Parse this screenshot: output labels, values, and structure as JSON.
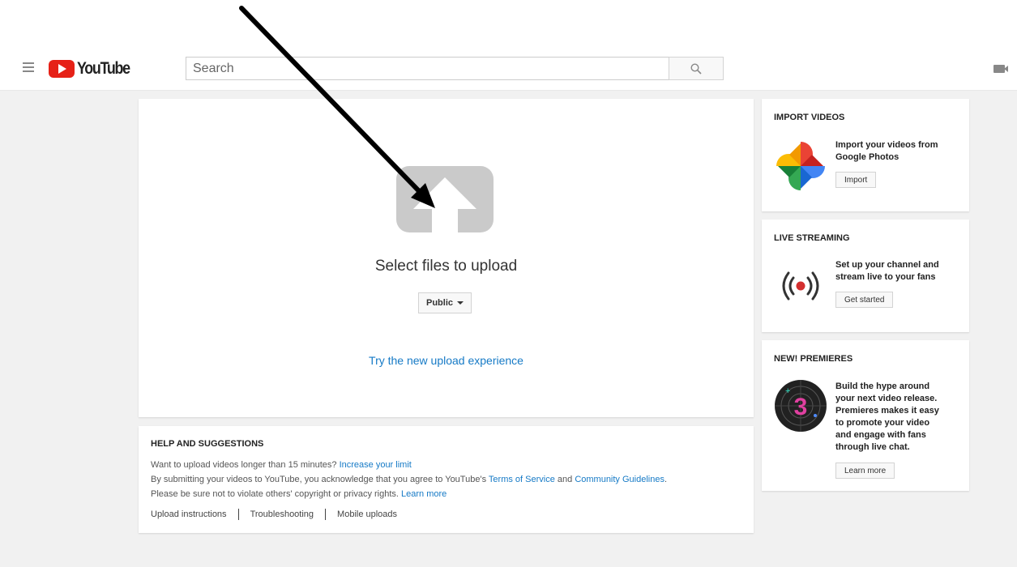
{
  "header": {
    "logo_text": "YouTube",
    "search_placeholder": "Search"
  },
  "upload": {
    "title": "Select files to upload",
    "privacy": "Public",
    "try_new": "Try the new upload experience"
  },
  "help": {
    "title": "HELP AND SUGGESTIONS",
    "line1_text": "Want to upload videos longer than 15 minutes? ",
    "line1_link": "Increase your limit",
    "line2_text": "By submitting your videos to YouTube, you acknowledge that you agree to YouTube's ",
    "line2_link1": "Terms of Service",
    "line2_and": " and ",
    "line2_link2": "Community Guidelines",
    "line2_end": ".",
    "line3_text": "Please be sure not to violate others' copyright or privacy rights. ",
    "line3_link": "Learn more",
    "links": [
      "Upload instructions",
      "Troubleshooting",
      "Mobile uploads"
    ]
  },
  "sidebar": {
    "import": {
      "title": "IMPORT VIDEOS",
      "text_1": "Import your videos from",
      "text_2": "Google Photos",
      "button": "Import"
    },
    "live": {
      "title": "LIVE STREAMING",
      "text_1": "Set up your channel and",
      "text_2": "stream live to your fans",
      "button": "Get started"
    },
    "premieres": {
      "title": "NEW! PREMIERES",
      "text_1": "Build the hype around",
      "text_2": "your next video release.",
      "text_3": "Premieres makes it easy",
      "text_4": "to promote your video",
      "text_5": "and engage with fans",
      "text_6": "through live chat.",
      "button": "Learn more",
      "badge_number": "3"
    }
  },
  "colors": {
    "link": "#167ac6",
    "brand_red": "#e62117",
    "live_red": "#d32f2f",
    "premiere_pink": "#e040a0"
  }
}
